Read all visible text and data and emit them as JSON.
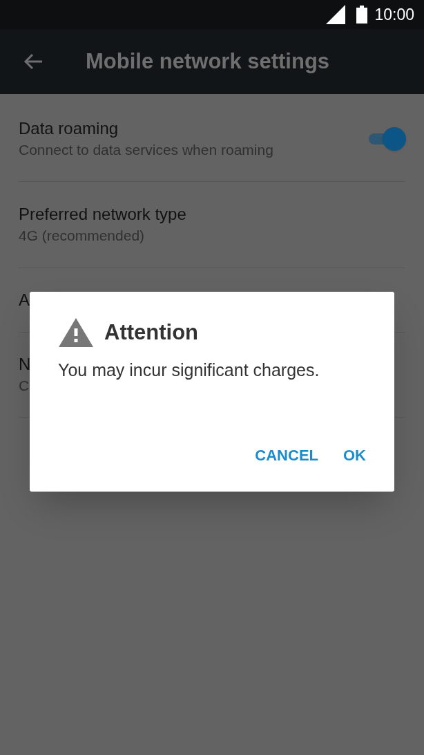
{
  "status_bar": {
    "time": "10:00"
  },
  "app_bar": {
    "title": "Mobile network settings"
  },
  "settings": [
    {
      "kind": "switch",
      "title": "Data roaming",
      "summary": "Connect to data services when roaming",
      "on": true
    },
    {
      "kind": "plain",
      "title": "Preferred network type",
      "summary": "4G (recommended)"
    },
    {
      "kind": "plain",
      "title": "A"
    },
    {
      "kind": "plain",
      "title": "N",
      "summary": "C"
    }
  ],
  "dialog": {
    "title": "Attention",
    "message": "You may incur significant charges.",
    "buttons": [
      "CANCEL",
      "OK"
    ]
  }
}
